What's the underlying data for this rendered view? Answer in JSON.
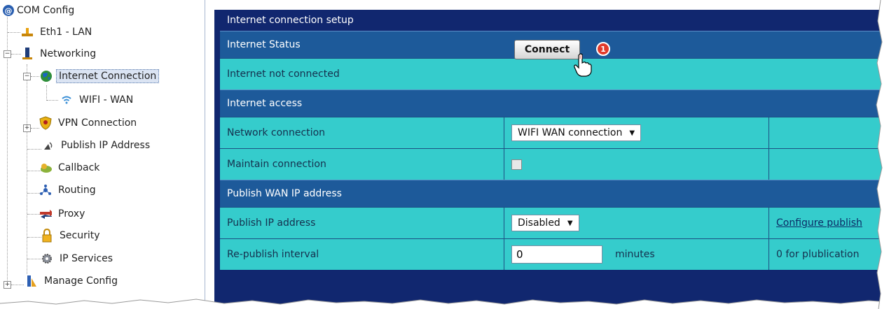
{
  "sidebar": {
    "root_label": "COM Config",
    "items": [
      {
        "label": "Eth1 - LAN",
        "icon": "lan-icon"
      },
      {
        "label": "Networking",
        "icon": "network-cable-icon"
      },
      {
        "label": "Internet Connection",
        "icon": "globe-icon"
      },
      {
        "label": "WIFI - WAN",
        "icon": "wifi-icon"
      },
      {
        "label": "VPN Connection",
        "icon": "shield-icon"
      },
      {
        "label": "Publish IP Address",
        "icon": "antenna-icon"
      },
      {
        "label": "Callback",
        "icon": "callback-icon"
      },
      {
        "label": "Routing",
        "icon": "routing-icon"
      },
      {
        "label": "Proxy",
        "icon": "proxy-arrows-icon"
      },
      {
        "label": "Security",
        "icon": "lock-icon"
      },
      {
        "label": "IP Services",
        "icon": "gear-icon"
      },
      {
        "label": "Manage Config",
        "icon": "config-icon"
      }
    ]
  },
  "panel": {
    "title": "Internet connection setup",
    "status_header": "Internet Status",
    "connect_label": "Connect",
    "step_number": "1",
    "status_text": "Internet not connected",
    "access_header": "Internet access",
    "network_connection_label": "Network connection",
    "network_connection_value": "WIFI WAN connection",
    "maintain_connection_label": "Maintain connection",
    "publish_header": "Publish WAN IP address",
    "publish_ip_label": "Publish IP address",
    "publish_ip_value": "Disabled",
    "configure_publish_link": "Configure publish",
    "republish_label": "Re-publish interval",
    "republish_value": "0",
    "republish_unit": "minutes",
    "republish_hint": "0 for plublication"
  },
  "colors": {
    "panel_bg": "#11276f",
    "section_bg": "#1d5a9a",
    "row_bg": "#35cccc",
    "step_badge": "#e23a2b"
  }
}
